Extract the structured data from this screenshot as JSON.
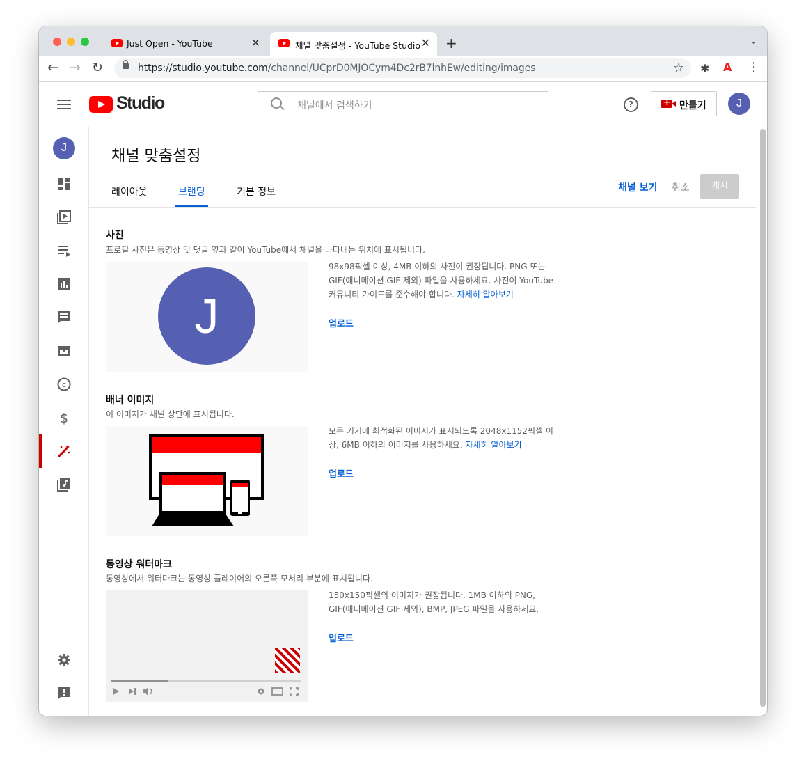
{
  "browser": {
    "tabs": [
      {
        "title": "Just Open - YouTube"
      },
      {
        "title": "채널 맞춤설정 - YouTube Studio"
      }
    ],
    "url_host": "https://studio.youtube.com",
    "url_path": "/channel/UCprD0MJOCym4Dc2rB7lnhEw/editing/images"
  },
  "header": {
    "logo_text": "Studio",
    "search_placeholder": "채널에서 검색하기",
    "create_label": "만들기",
    "avatar_initial": "J"
  },
  "sidebar": {
    "avatar_initial": "J",
    "items": [
      {
        "icon": "dashboard-icon"
      },
      {
        "icon": "content-icon"
      },
      {
        "icon": "playlists-icon"
      },
      {
        "icon": "analytics-icon"
      },
      {
        "icon": "comments-icon"
      },
      {
        "icon": "subtitles-icon"
      },
      {
        "icon": "copyright-icon"
      },
      {
        "icon": "monetization-icon"
      },
      {
        "icon": "customization-icon",
        "active": true
      },
      {
        "icon": "audio-library-icon"
      }
    ],
    "bottom": [
      {
        "icon": "settings-icon"
      },
      {
        "icon": "feedback-icon"
      }
    ]
  },
  "page": {
    "title": "채널 맞춤설정",
    "tabs": [
      "레이아웃",
      "브랜딩",
      "기본 정보"
    ],
    "active_tab": "브랜딩",
    "view_channel": "채널 보기",
    "cancel": "취소",
    "publish": "게시"
  },
  "sections": {
    "photo": {
      "title": "사진",
      "desc": "프로필 사진은 동영상 및 댓글 옆과 같이 YouTube에서 채널을 나타내는 위치에 표시됩니다.",
      "avatar_initial": "J",
      "info_line1": "98x98픽셀 이상, 4MB 이하의 사진이 권장됩니다. PNG 또는",
      "info_line2": "GIF(애니메이션 GIF 제외) 파일을 사용하세요. 사진이 YouTube",
      "info_line3": "커뮤니티 가이드를 준수해야 합니다.",
      "link": "자세히 알아보기",
      "upload": "업로드"
    },
    "banner": {
      "title": "배너 이미지",
      "desc": "이 이미지가 채널 상단에 표시됩니다.",
      "info_line1": "모든 기기에 최적화된 이미지가 표시되도록 2048x1152픽셀 이",
      "info_line2": "상, 6MB 이하의 이미지를 사용하세요.",
      "link": "자세히 알아보기",
      "upload": "업로드"
    },
    "watermark": {
      "title": "동영상 워터마크",
      "desc": "동영상에서 워터마크는 동영상 플레이어의 오른쪽 모서리 부분에 표시됩니다.",
      "info_line1": "150x150픽셀의 이미지가 권장됩니다. 1MB 이하의 PNG,",
      "info_line2": "GIF(애니메이션 GIF 제외), BMP, JPEG 파일을 사용하세요.",
      "upload": "업로드"
    }
  },
  "colors": {
    "accent": "#065fd4",
    "brand_red": "#ff0000",
    "avatar": "#5660b3"
  }
}
